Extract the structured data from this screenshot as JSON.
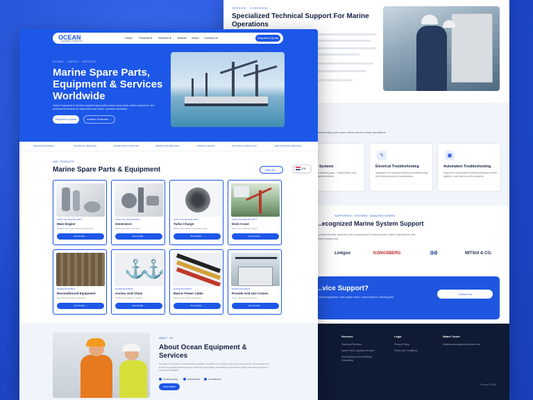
{
  "back_page": {
    "section_eyebrow": "SERVICE · OVERVIEW",
    "section_title": "Specialized Technical Support For Marine Operations",
    "services_sub": "troubleshooting and repair needs across vessel operations.",
    "service_cards": [
      {
        "title": "...Gear Systems",
        "desc": "Support for steering gear, ...replacement, and vessel equipment needs."
      },
      {
        "title": "Electrical Troubleshooting",
        "desc": "Assistance for onboard electrical troubleshooting and technical service requirements."
      },
      {
        "title": "Automation Troubleshooting",
        "desc": "Support for automation troubleshooting and alarm systems, and marine control systems."
      }
    ],
    "brands_eyebrow": "SUPPORTED · SYSTEMS · MANUFACTURERS",
    "brands_title": "...ecognized Marine System Support",
    "brands_sub": "...ported include systems and manufacturers used across marine operations and vessel equipment.",
    "brands": [
      "Linkgso",
      "KONGSBERG",
      "IHI",
      "MITSUI & CO."
    ],
    "cta_title": "...vice Support?",
    "cta_sub": "...marine equipment, main engine works, control systems, steering gear.",
    "cta_button": "Contact Us",
    "footer": {
      "col1_title": "Services",
      "col1_links": [
        "Technical Services",
        "Spare Parts Logistics Services",
        "Dry Docking & New Building Consulting"
      ],
      "col2_title": "Legal",
      "col2_links": [
        "Privacy Policy",
        "Terms and Conditions"
      ],
      "col3_title": "Watch Touch",
      "col3_links": [
        "info@oceanequipmentservice.com"
      ],
      "copyright": "Privacy & 2025 ...."
    }
  },
  "front_page": {
    "nav": {
      "logo": "OCEAN",
      "logo_sub": "EQUIPMENT & SERVICES",
      "links": [
        "Home",
        "Products ▾",
        "Services ▾",
        "Brands",
        "About",
        "Contact Us"
      ],
      "cta": "Request a Quote"
    },
    "hero": {
      "eyebrow": "GLOBAL · SUPPLY · SUPPORT",
      "title": "Marine Spare Parts, Equipment & Services Worldwide",
      "desc": "Ocean Equipment & Services supplies high-quality marine spare parts, marine equipment, and professional services for shipowners and marine operators worldwide.",
      "button_primary": "Request a Quote",
      "button_secondary": "Explore Products →"
    },
    "strip": [
      "MARINE EQUIPMENT",
      "TECHNICAL SERVICES",
      "SPARE PARTS SUPPLIES",
      "INSPECTION SERVICES",
      "PUMPS & VALVES",
      "DRY DOCK CONSULTING",
      "NEW BUILDING SERVICES"
    ],
    "products": {
      "eyebrow": "OUR · PRODUCTS",
      "title": "Marine Spare Parts & Equipment",
      "view_all": "View All →",
      "language": "EN",
      "items": [
        {
          "category": "SUPPLYING GENUINE PARTS",
          "name": "Main Engine",
          "desc": "Reliable main engine parts and equipment.",
          "button": "View Details →"
        },
        {
          "category": "SUPPLYING GENUINE PARTS",
          "name": "Generators",
          "desc": "Marine generators and parts.",
          "button": "View Details →"
        },
        {
          "category": "SUPPLYING GENUINE PARTS",
          "name": "Turbo Charge",
          "desc": "Marine turbochargers and related parts.",
          "button": "View Details →"
        },
        {
          "category": "SUPPLYING GENUINE PARTS",
          "name": "Deck Crane",
          "desc": "Deck crane parts and support.",
          "button": "View Details →"
        },
        {
          "category": "MARINE EQUIPMENT",
          "name": "Reconditioned Equipment",
          "desc": "Reconditioned marine equipment.",
          "button": "View Details →"
        },
        {
          "category": "MARINE EQUIPMENT",
          "name": "Anchor And Chain",
          "desc": "Anchors and chains for vessels.",
          "button": "View Details →"
        },
        {
          "category": "MARINE EQUIPMENT",
          "name": "Marine Power Cable",
          "desc": "Marine power cables and wiring.",
          "button": "View Details →"
        },
        {
          "category": "MARINE EQUIPMENT",
          "name": "Provide And Use Cranes",
          "desc": "Crane provision and services.",
          "button": "View Details →"
        }
      ]
    },
    "about": {
      "eyebrow": "ABOUT · US",
      "title": "About Ocean Equipment & Services",
      "desc": "Founded on the pillars of craftsmanship, reliability and efficiency to supply marine parts and services. Ocean Equipment & Services provides effective support, delivering high quality, competitively priced marine spare parts and equipment to customers worldwide.",
      "checks": [
        "Certified Quality",
        "Global Reach",
        "Cost Effective"
      ],
      "button": "Learn More"
    }
  }
}
